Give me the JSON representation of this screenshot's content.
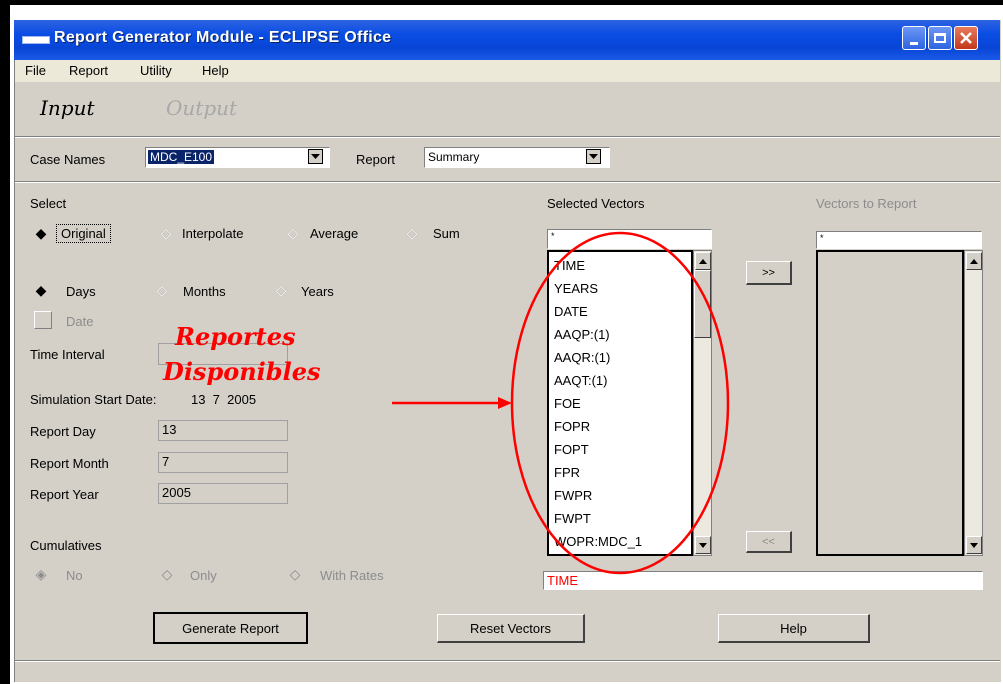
{
  "window": {
    "title": "Report Generator Module - ECLIPSE Office"
  },
  "menu": [
    "File",
    "Report",
    "Utility",
    "Help"
  ],
  "io_tabs": {
    "input": "Input",
    "output": "Output"
  },
  "case": {
    "label": "Case Names",
    "value": "MDC_E100",
    "report_label": "Report",
    "report_value": "Summary"
  },
  "select": {
    "label": "Select",
    "modes": [
      "Original",
      "Interpolate",
      "Average",
      "Sum"
    ],
    "selected_mode": "Original",
    "periods": [
      "Days",
      "Months",
      "Years"
    ],
    "selected_period": "Days",
    "date_label": "Date",
    "time_interval_label": "Time Interval",
    "sim_start_label": "Simulation Start Date:",
    "sim_start_value": "13  7  2005",
    "report_day_label": "Report Day",
    "report_day_value": "13",
    "report_month_label": "Report Month",
    "report_month_value": "7",
    "report_year_label": "Report Year",
    "report_year_value": "2005",
    "cumulatives_label": "Cumulatives",
    "cumulative_options": [
      "No",
      "Only",
      "With Rates"
    ],
    "selected_cumulative": "No"
  },
  "selected_vectors": {
    "label": "Selected Vectors",
    "filter": "*",
    "items": [
      "TIME",
      "YEARS",
      "DATE",
      "AAQP:(1)",
      "AAQR:(1)",
      "AAQT:(1)",
      "FOE",
      "FOPR",
      "FOPT",
      "FPR",
      "FWPR",
      "FWPT",
      "WOPR:MDC_1"
    ],
    "current": "TIME"
  },
  "vectors_to_report": {
    "label": "Vectors to Report",
    "filter": "*"
  },
  "transfer": {
    "add": ">>",
    "remove": "<<"
  },
  "buttons": {
    "generate": "Generate Report",
    "reset": "Reset Vectors",
    "help": "Help"
  },
  "annotation": {
    "line1": "Reportes",
    "line2": "Disponibles",
    "color": "#ff0000"
  }
}
